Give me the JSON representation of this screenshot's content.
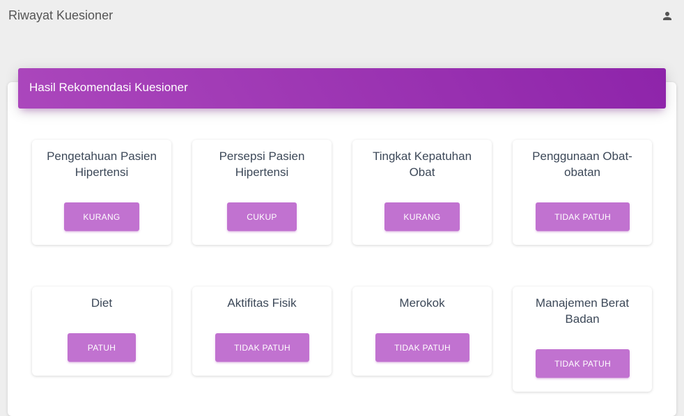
{
  "app": {
    "title": "Riwayat Kuesioner",
    "user_icon": "person-icon"
  },
  "panel": {
    "header_title": "Hasil Rekomendasi Kuesioner",
    "accent_color": "#9c27b0",
    "button_color": "#c172d0"
  },
  "results": [
    {
      "title_line1": "Pengetahuan Pasien",
      "title_line2": "Hipertensi",
      "status": "KURANG"
    },
    {
      "title_line1": "Persepsi Pasien",
      "title_line2": "Hipertensi",
      "status": "CUKUP"
    },
    {
      "title_line1": "Tingkat Kepatuhan",
      "title_line2": "Obat",
      "status": "KURANG"
    },
    {
      "title_line1": "Penggunaan Obat-",
      "title_line2": "obatan",
      "status": "TIDAK PATUH"
    },
    {
      "title_line1": "Diet",
      "title_line2": "",
      "status": "PATUH"
    },
    {
      "title_line1": "Aktifitas Fisik",
      "title_line2": "",
      "status": "TIDAK PATUH"
    },
    {
      "title_line1": "Merokok",
      "title_line2": "",
      "status": "TIDAK PATUH"
    },
    {
      "title_line1": "Manajemen Berat",
      "title_line2": "Badan",
      "status": "TIDAK PATUH"
    }
  ]
}
